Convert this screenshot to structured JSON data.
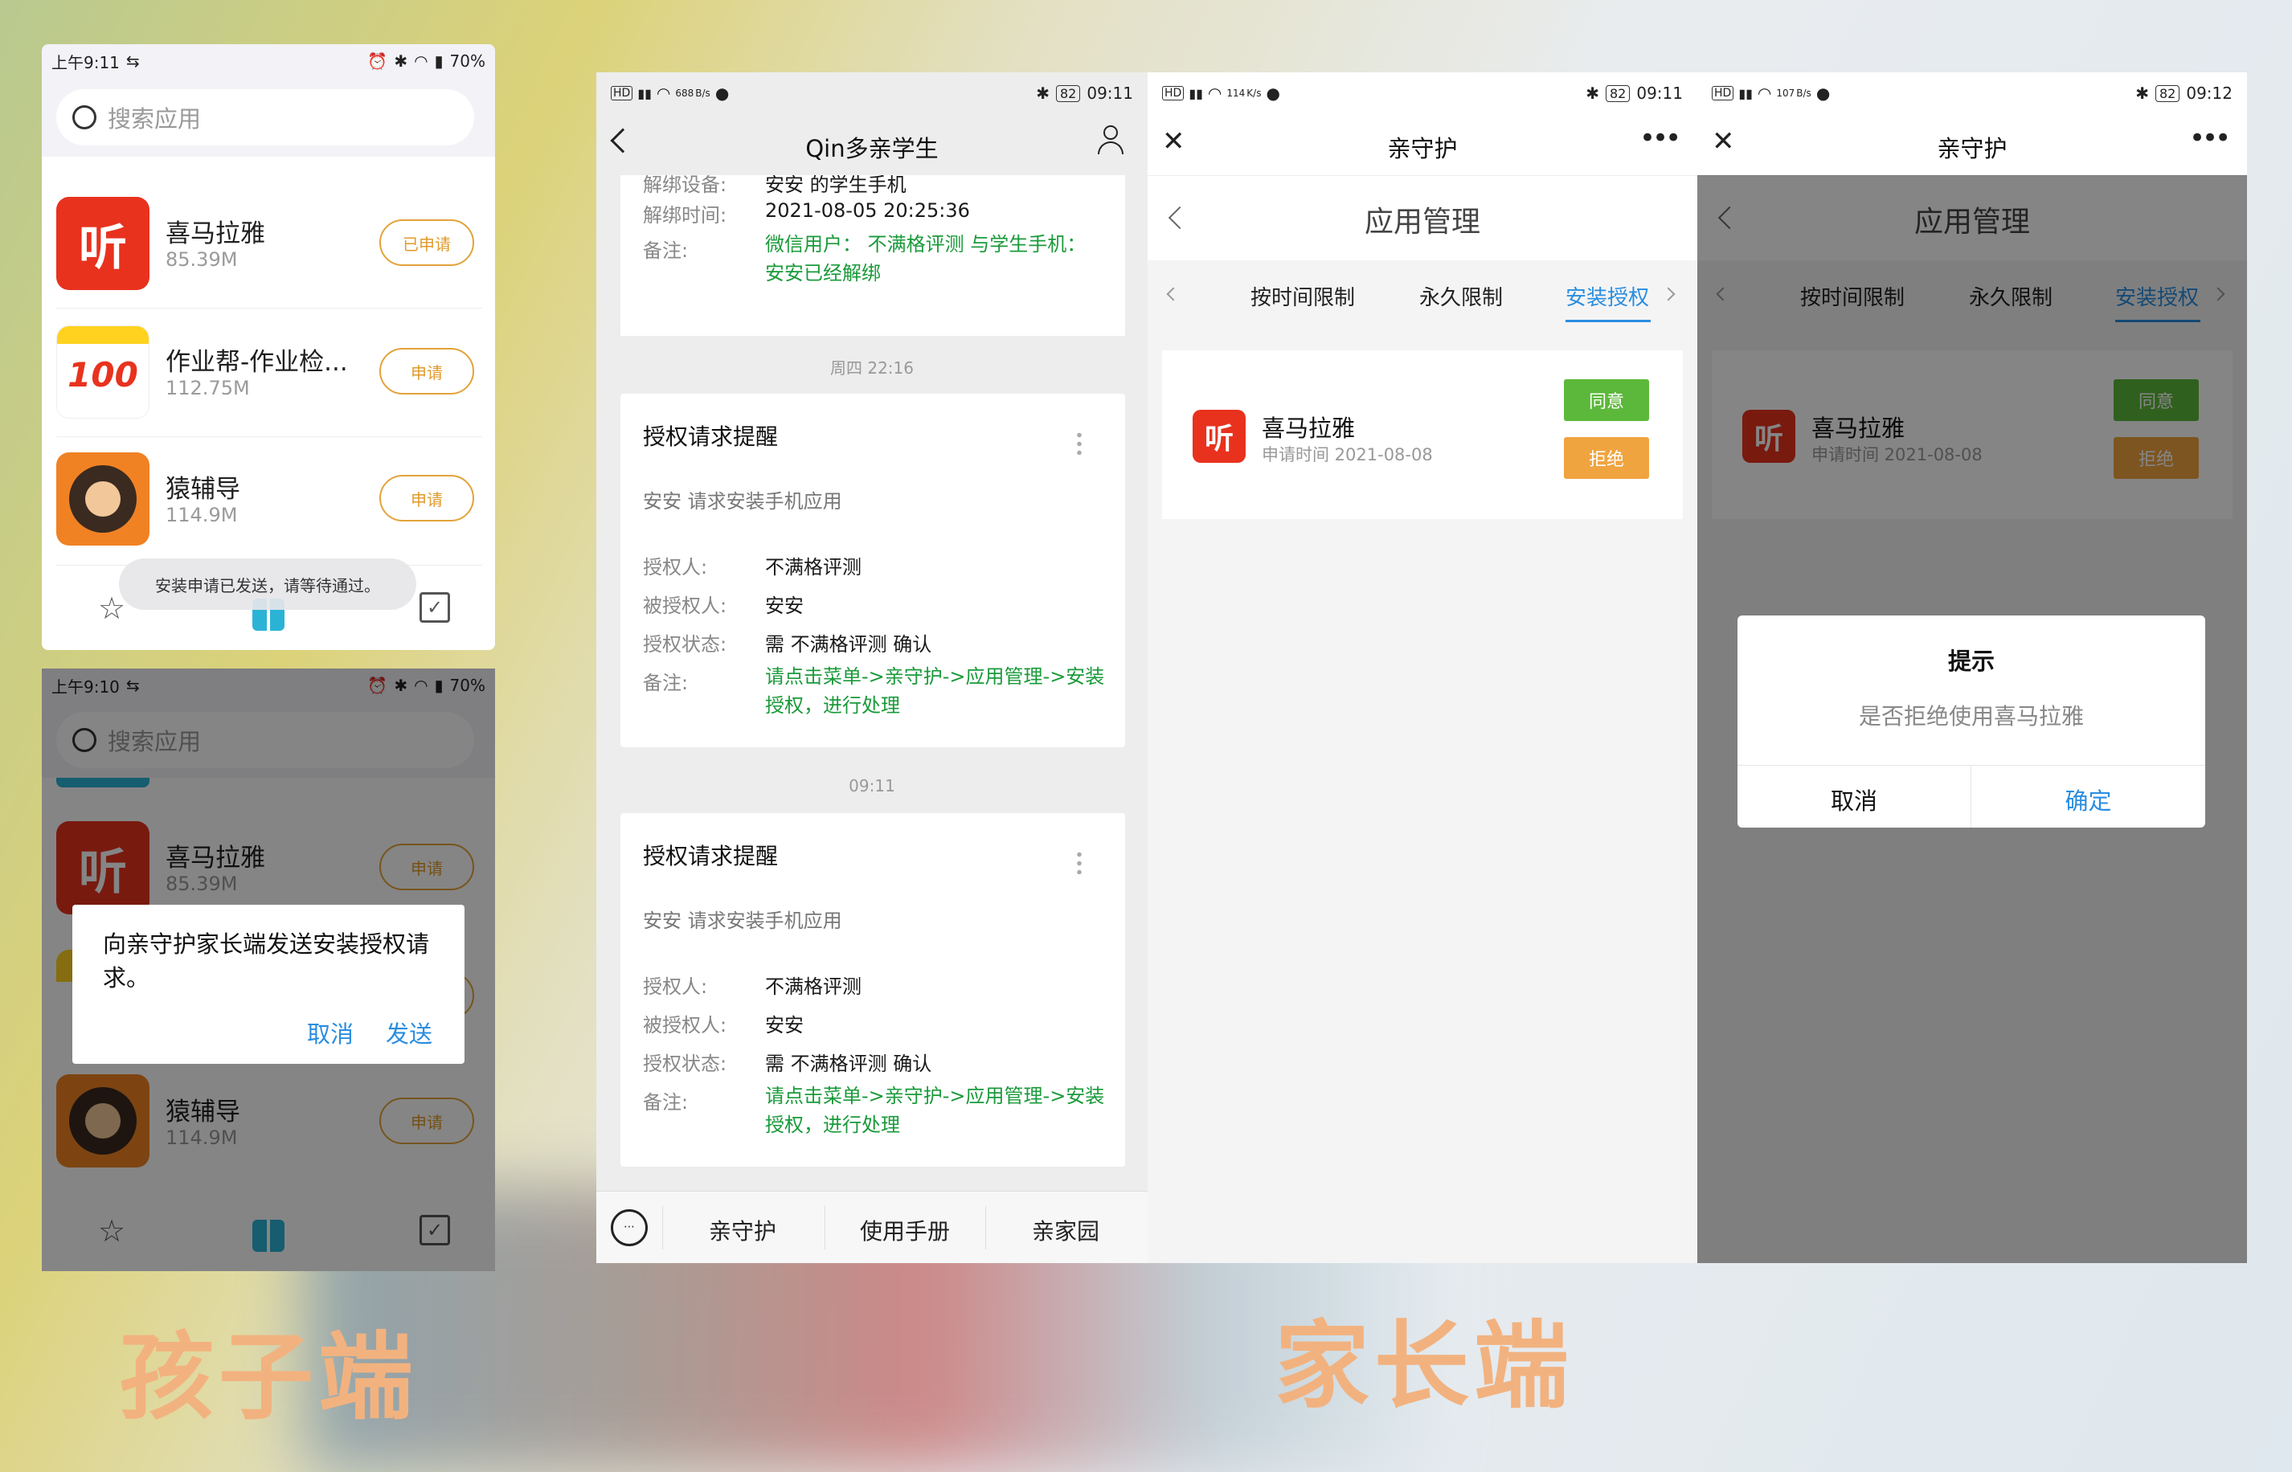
{
  "child": {
    "p1": {
      "time": "上午9:11",
      "battery": "70%",
      "search_placeholder": "搜索应用",
      "apps": [
        {
          "name": "喜马拉雅",
          "size": "85.39M",
          "btn": "已申请"
        },
        {
          "name": "作业帮-作业检...",
          "size": "112.75M",
          "btn": "申请"
        },
        {
          "name": "猿辅导",
          "size": "114.9M",
          "btn": "申请"
        }
      ],
      "toast": "安装申请已发送，请等待通过。"
    },
    "p2": {
      "time": "上午9:10",
      "battery": "70%",
      "search_placeholder": "搜索应用",
      "apps": [
        {
          "name": "喜马拉雅",
          "size": "85.39M",
          "btn": "申请"
        },
        {
          "name": "猿辅导",
          "size": "114.9M",
          "btn": "申请"
        }
      ],
      "dialog": {
        "text": "向亲守护家长端发送安装授权请求。",
        "cancel": "取消",
        "send": "发送"
      }
    },
    "label": "孩子端"
  },
  "parent": {
    "chat": {
      "time": "09:11",
      "speed": "688",
      "speed_unit": "B/s",
      "battery": "82",
      "title": "Qin多亲学生",
      "top_card": {
        "cut_label": "解绑设备:",
        "cut_value": "安安 的学生手机",
        "unbind_time_label": "解绑时间:",
        "unbind_time": "2021-08-05 20:25:36",
        "note_label": "备注:",
        "note": "微信用户： 不满格评测 与学生手机：  安安已经解绑"
      },
      "stamp1": "周四 22:16",
      "stamp2": "09:11",
      "msg": {
        "title": "授权请求提醒",
        "sub": "安安 请求安装手机应用",
        "grantor_label": "授权人:",
        "grantor": "不满格评测",
        "grantee_label": "被授权人:",
        "grantee": "安安",
        "status_label": "授权状态:",
        "status": "需 不满格评测 确认",
        "note_label": "备注:",
        "note": "请点击菜单->亲守护->应用管理->安装授权，进行处理"
      },
      "menu": [
        "亲守护",
        "使用手册",
        "亲家园"
      ]
    },
    "mgmt": {
      "time": "09:11",
      "speed": "114",
      "speed_unit": "K/s",
      "battery": "82",
      "nav_title": "亲守护",
      "page_title": "应用管理",
      "tabs": [
        "按时间限制",
        "永久限制",
        "安装授权"
      ],
      "app": {
        "name": "喜马拉雅",
        "date": "申请时间 2021-08-08",
        "agree": "同意",
        "reject": "拒绝"
      }
    },
    "confirm": {
      "time": "09:12",
      "speed": "107",
      "speed_unit": "B/s",
      "battery": "82",
      "nav_title": "亲守护",
      "page_title": "应用管理",
      "tabs": [
        "按时间限制",
        "永久限制",
        "安装授权"
      ],
      "app": {
        "name": "喜马拉雅",
        "date": "申请时间 2021-08-08",
        "agree": "同意",
        "reject": "拒绝"
      },
      "dialog": {
        "title": "提示",
        "text": "是否拒绝使用喜马拉雅",
        "cancel": "取消",
        "ok": "确定"
      }
    },
    "label": "家长端"
  },
  "colors": {
    "green": "#1a9a3a",
    "blue": "#2a8de0",
    "orange_pill": "#e2a33a",
    "ting_red": "#e8321e",
    "agree": "#5cb83a",
    "reject": "#f0a440"
  }
}
